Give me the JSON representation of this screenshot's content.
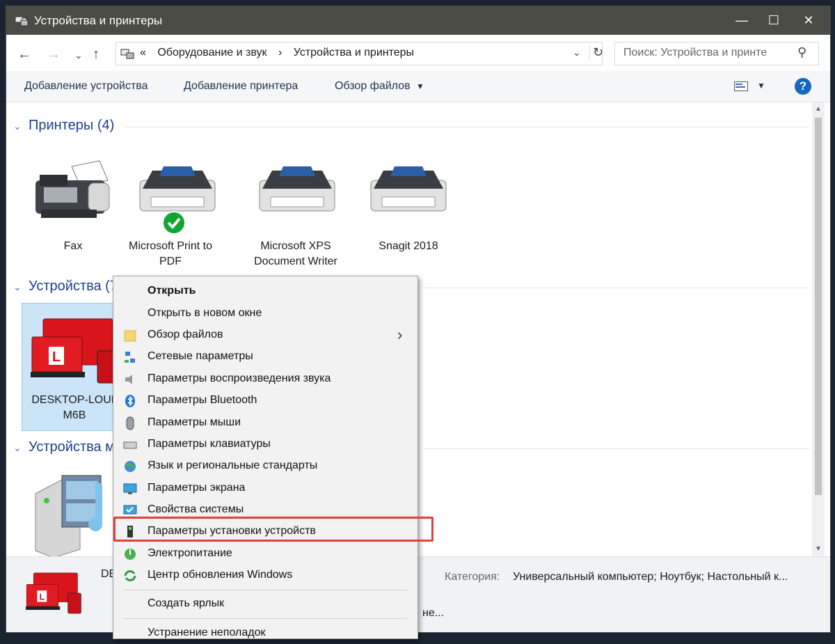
{
  "window": {
    "title": "Устройства и принтеры",
    "controls": {
      "minimize": "—",
      "maximize": "☐",
      "close": "✕"
    }
  },
  "address_bar": {
    "back": "←",
    "forward": "→",
    "recent": "⌄",
    "up": "↑",
    "crumbs": [
      "«",
      "Оборудование и звук",
      "›",
      "Устройства и принтеры"
    ],
    "dropdown": "⌄",
    "refresh": "↻",
    "search_placeholder": "Поиск: Устройства и принте",
    "search_icon": "⚲"
  },
  "command_bar": {
    "add_device": "Добавление устройства",
    "add_printer": "Добавление принтера",
    "browse_files": "Обзор файлов",
    "browse_arrow": "▼",
    "view_arrow": "▼",
    "help": "?"
  },
  "groups": {
    "printers": {
      "title": "Принтеры (4)",
      "items": [
        {
          "label": "Fax",
          "icon": "fax-icon"
        },
        {
          "label": "Microsoft Print to PDF",
          "icon": "printer-icon",
          "default": true
        },
        {
          "label": "Microsoft XPS Document Writer",
          "icon": "printer-icon"
        },
        {
          "label": "Snagit 2018",
          "icon": "printer-icon"
        }
      ]
    },
    "devices": {
      "title": "Устройства (7",
      "items": [
        {
          "label": "DESKTOP-LOUL M6B",
          "icon": "computer-devices-icon"
        }
      ]
    },
    "multimedia": {
      "title": "Устройства м",
      "items": [
        {
          "label": "",
          "icon": "media-server-icon"
        }
      ]
    }
  },
  "details_pane": {
    "name": "DE",
    "category_label": "Категория:",
    "category_value": "Универсальный компьютер; Ноутбук; Настольный к...",
    "extra": "не..."
  },
  "context_menu": {
    "items": [
      {
        "label": "Открыть",
        "bold": true,
        "icon": ""
      },
      {
        "label": "Открыть в новом окне",
        "icon": ""
      },
      {
        "label": "Обзор файлов",
        "icon": "folder-icon",
        "submenu": "›"
      },
      {
        "label": "Сетевые параметры",
        "icon": "network-icon"
      },
      {
        "label": "Параметры воспроизведения звука",
        "icon": "speaker-icon"
      },
      {
        "label": "Параметры Bluetooth",
        "icon": "bluetooth-icon"
      },
      {
        "label": "Параметры мыши",
        "icon": "mouse-icon"
      },
      {
        "label": "Параметры клавиатуры",
        "icon": "keyboard-icon"
      },
      {
        "label": "Язык и региональные стандарты",
        "icon": "globe-icon"
      },
      {
        "label": "Параметры экрана",
        "icon": "monitor-icon"
      },
      {
        "label": "Свойства системы",
        "icon": "monitor-check-icon"
      },
      {
        "label": "Параметры установки устройств",
        "icon": "usb-device-icon",
        "highlighted": true
      },
      {
        "label": "Электропитание",
        "icon": "power-icon"
      },
      {
        "label": "Центр обновления Windows",
        "icon": "windows-update-icon"
      },
      {
        "label": "Создать ярлык",
        "icon": ""
      },
      {
        "label": "Устранение неполадок",
        "icon": ""
      }
    ]
  },
  "colors": {
    "titlebar": "#4a4c45",
    "group_heading": "#1e3f8b",
    "highlight_box": "#e0413b",
    "selection": "#cce4f7",
    "device_red": "#d9141b"
  }
}
